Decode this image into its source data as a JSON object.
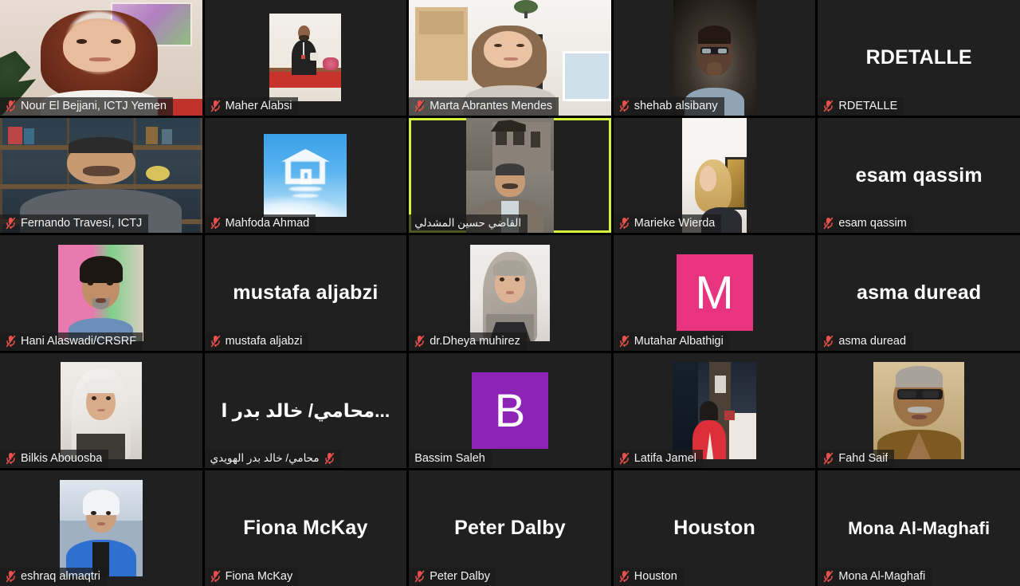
{
  "app": {
    "name": "Zoom Meeting",
    "view": "gallery-view",
    "grid": {
      "columns": 5,
      "rows": 5
    },
    "active_speaker_border_color": "#d4f53c",
    "muted_icon_color": "#e8504c",
    "tile_background": "#202020",
    "label_background": "rgba(26,26,26,0.72)"
  },
  "participants": [
    {
      "id": 1,
      "label": "Nour El Bejjani, ICTJ Yemen",
      "muted": true,
      "type": "video",
      "active": false
    },
    {
      "id": 2,
      "label": "Maher Alabsi",
      "muted": true,
      "type": "video",
      "active": false
    },
    {
      "id": 3,
      "label": "Marta Abrantes Mendes",
      "muted": true,
      "type": "video",
      "active": false
    },
    {
      "id": 4,
      "label": "shehab alsibany",
      "muted": true,
      "type": "video",
      "active": false
    },
    {
      "id": 5,
      "label": "RDETALLE",
      "muted": true,
      "type": "name",
      "active": false,
      "display_name": "RDETALLE"
    },
    {
      "id": 6,
      "label": "Fernando Travesí, ICTJ",
      "muted": true,
      "type": "video",
      "active": false
    },
    {
      "id": 7,
      "label": "Mahfoda  Ahmad",
      "muted": true,
      "type": "avatar",
      "active": false
    },
    {
      "id": 8,
      "label": "القاضي حسين المشدلي",
      "muted": false,
      "type": "video",
      "active": true,
      "rtl": true
    },
    {
      "id": 9,
      "label": "Marieke Wierda",
      "muted": true,
      "type": "video",
      "active": false
    },
    {
      "id": 10,
      "label": "esam qassim",
      "muted": true,
      "type": "name",
      "active": false,
      "display_name": "esam qassim"
    },
    {
      "id": 11,
      "label": "Hani Alaswadi/CRSRF",
      "muted": true,
      "type": "avatar",
      "active": false
    },
    {
      "id": 12,
      "label": "mustafa aljabzi",
      "muted": true,
      "type": "name",
      "active": false,
      "display_name": "mustafa aljabzi"
    },
    {
      "id": 13,
      "label": "dr.Dheya muhirez",
      "muted": true,
      "type": "avatar",
      "active": false
    },
    {
      "id": 14,
      "label": "Mutahar Albathigi",
      "muted": true,
      "type": "initial",
      "active": false,
      "initial": "M",
      "initial_color": "#e8337f"
    },
    {
      "id": 15,
      "label": "asma duread",
      "muted": true,
      "type": "name",
      "active": false,
      "display_name": "asma duread"
    },
    {
      "id": 16,
      "label": "Bilkis Abouosba",
      "muted": true,
      "type": "avatar",
      "active": false
    },
    {
      "id": 17,
      "label": "محامي/ خالد بدر الهويدي",
      "muted": true,
      "type": "name",
      "active": false,
      "display_name": "...محامي/ خالد بدر ا",
      "rtl": true
    },
    {
      "id": 18,
      "label": "Bassim Saleh",
      "muted": false,
      "type": "initial",
      "active": false,
      "initial": "B",
      "initial_color": "#8e23b8"
    },
    {
      "id": 19,
      "label": "Latifa Jamel",
      "muted": true,
      "type": "video",
      "active": false
    },
    {
      "id": 20,
      "label": "Fahd Saif",
      "muted": true,
      "type": "avatar",
      "active": false
    },
    {
      "id": 21,
      "label": "eshraq almaqtri",
      "muted": true,
      "type": "avatar",
      "active": false
    },
    {
      "id": 22,
      "label": "Fiona McKay",
      "muted": true,
      "type": "name",
      "active": false,
      "display_name": "Fiona McKay"
    },
    {
      "id": 23,
      "label": "Peter Dalby",
      "muted": true,
      "type": "name",
      "active": false,
      "display_name": "Peter Dalby"
    },
    {
      "id": 24,
      "label": "Houston",
      "muted": true,
      "type": "name",
      "active": false,
      "display_name": "Houston"
    },
    {
      "id": 25,
      "label": "Mona Al-Maghafi",
      "muted": true,
      "type": "name",
      "active": false,
      "display_name": "Mona Al-Maghafi"
    }
  ]
}
